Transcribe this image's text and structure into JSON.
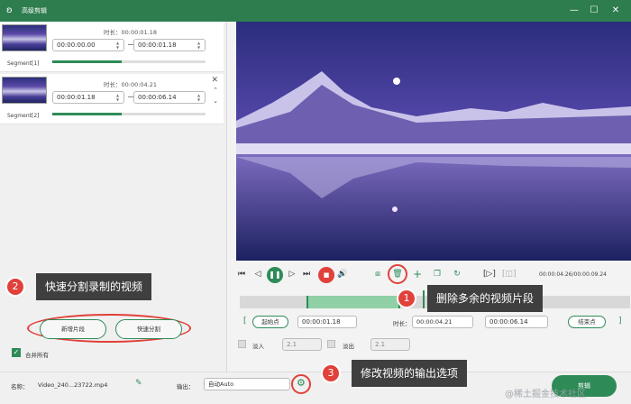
{
  "window": {
    "title": "高级剪辑"
  },
  "segments": [
    {
      "name": "Segment[1]",
      "duration_label": "时长：",
      "duration": "00:00:01.18",
      "start": "00:00:00.00",
      "end": "00:00:01.18",
      "progress": 0.45
    },
    {
      "name": "Segment[2]",
      "duration_label": "时长：",
      "duration": "00:00:04.21",
      "start": "00:00:01.18",
      "end": "00:00:06.14",
      "progress": 0.45
    }
  ],
  "callouts": {
    "c1": {
      "num": "1",
      "text": "删除多余的视频片段"
    },
    "c2": {
      "num": "2",
      "text": "快速分割录制的视频"
    },
    "c3": {
      "num": "3",
      "text": "修改视频的输出选项"
    }
  },
  "left_buttons": {
    "new_segment": "新增片段",
    "quick_split": "快速分割",
    "merge_label": "合并所有",
    "merge_checked": true
  },
  "playback": {
    "time_display": "00:00:04.26/00:00:09.24"
  },
  "trim": {
    "start_btn": "起始点",
    "start_value": "00:00:01.18",
    "duration_label": "时长：",
    "duration_value": "00:00:04.21",
    "end_value": "00:00:06.14",
    "end_btn": "结束点"
  },
  "fades": {
    "fade_in_label": "淡入",
    "fade_in_value": "2.1",
    "fade_out_label": "淡出",
    "fade_out_value": "2.1"
  },
  "bottom": {
    "name_label": "名称：",
    "file_name": "Video_240...23722.mp4",
    "output_label": "输出：",
    "output_value": "自动Auto",
    "cut_button": "剪辑"
  },
  "watermark": "@稀土掘金技术社区",
  "colors": {
    "accent": "#2e8b57",
    "callout_badge": "#e0413a",
    "titlebar": "#2e7d4f"
  }
}
